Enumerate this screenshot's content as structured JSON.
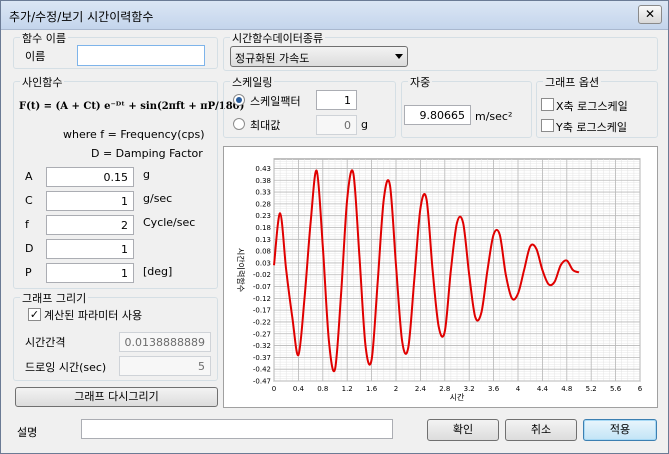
{
  "window": {
    "title": "추가/수정/보기 시간이력함수",
    "close_glyph": "✕"
  },
  "name_group": {
    "title": "함수 이름",
    "label": "이름",
    "value": ""
  },
  "data_type_group": {
    "title": "시간함수데이터종류",
    "selected": "정규화된 가속도"
  },
  "sine_group": {
    "title": "사인함수",
    "formula": "F(t) = (A + Ct) e⁻ᴰᵗ + sin(2πft + πP/180)",
    "where1": "where f = Frequency(cps)",
    "where2": "D = Damping Factor",
    "params": [
      {
        "name": "A",
        "value": "0.15",
        "unit": "g"
      },
      {
        "name": "C",
        "value": "1",
        "unit": "g/sec"
      },
      {
        "name": "f",
        "value": "2",
        "unit": "Cycle/sec"
      },
      {
        "name": "D",
        "value": "1",
        "unit": ""
      },
      {
        "name": "P",
        "value": "1",
        "unit": "[deg]"
      }
    ]
  },
  "scale_group": {
    "title": "스케일링",
    "opt1_label": "스케일팩터",
    "opt1_value": "1",
    "opt2_label": "최대값",
    "opt2_value": "0",
    "opt2_unit": "g",
    "selected": "스케일팩터"
  },
  "gravity_group": {
    "title": "자중",
    "value": "9.80665",
    "unit": "m/sec²"
  },
  "graph_opt_group": {
    "title": "그래프 옵션",
    "x_log_label": "X축 로그스케일",
    "y_log_label": "Y축 로그스케일",
    "x_log": false,
    "y_log": false
  },
  "draw_group": {
    "title": "그래프 그리기",
    "use_calc_label": "계산된 파라미터 사용",
    "use_calc": true,
    "interval_label": "시간간격",
    "interval_value": "0.0138888889",
    "duration_label": "드로잉 시간(sec)",
    "duration_value": "5"
  },
  "redraw_button": "그래프 다시그리기",
  "description": {
    "label": "설명",
    "value": ""
  },
  "buttons": {
    "ok": "확인",
    "cancel": "취소",
    "apply": "적용"
  },
  "chart_data": {
    "type": "line",
    "xlabel": "시간",
    "ylabel": "시간이력함수",
    "xlim": [
      0,
      6
    ],
    "ylim": [
      -0.47,
      0.47
    ],
    "x_ticks": [
      "0",
      "0.4",
      "0.8",
      "1.2",
      "1.6",
      "2",
      "2.4",
      "2.8",
      "3.2",
      "3.6",
      "4",
      "4.4",
      "4.8",
      "5.2",
      "5.6",
      "6"
    ],
    "y_ticks": [
      "0.43",
      "0.38",
      "0.33",
      "0.28",
      "0.23",
      "0.18",
      "0.13",
      "0.08",
      "0.03",
      "-0.02",
      "-0.07",
      "-0.12",
      "-0.17",
      "-0.22",
      "-0.27",
      "-0.32",
      "-0.37",
      "-0.42",
      "-0.47"
    ],
    "grid": true,
    "series": [
      {
        "color": "#e00000",
        "x": [
          0,
          0.1,
          0.2,
          0.3,
          0.4,
          0.5,
          0.6,
          0.7,
          0.8,
          0.9,
          1.0,
          1.1,
          1.2,
          1.3,
          1.4,
          1.5,
          1.6,
          1.7,
          1.8,
          1.9,
          2.0,
          2.1,
          2.2,
          2.3,
          2.4,
          2.5,
          2.6,
          2.7,
          2.8,
          2.9,
          3.0,
          3.1,
          3.2,
          3.3,
          3.4,
          3.5,
          3.6,
          3.7,
          3.8,
          3.9,
          4.0,
          4.1,
          4.2,
          4.3,
          4.4,
          4.5,
          4.6,
          4.7,
          4.8,
          4.9,
          5.0
        ],
        "y": [
          0.02,
          0.24,
          0.0,
          -0.2,
          -0.36,
          -0.12,
          0.2,
          0.42,
          0.1,
          -0.3,
          -0.42,
          -0.1,
          0.3,
          0.41,
          0.06,
          -0.32,
          -0.38,
          -0.05,
          0.3,
          0.36,
          0.02,
          -0.3,
          -0.33,
          -0.04,
          0.26,
          0.3,
          0.0,
          -0.24,
          -0.26,
          0.0,
          0.2,
          0.2,
          -0.02,
          -0.2,
          -0.18,
          0.0,
          0.15,
          0.15,
          -0.02,
          -0.12,
          -0.1,
          0.0,
          0.1,
          0.09,
          0.0,
          -0.06,
          -0.05,
          0.02,
          0.04,
          0.0,
          -0.01
        ]
      }
    ]
  }
}
